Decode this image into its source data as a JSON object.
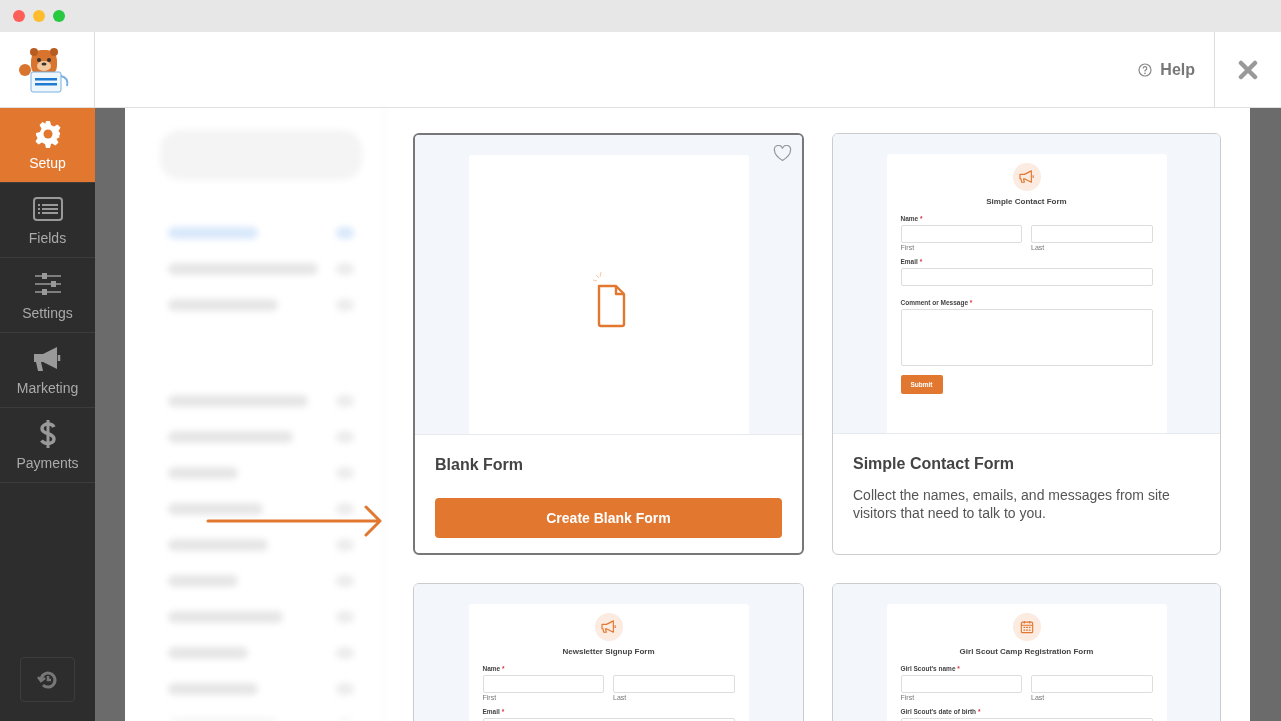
{
  "nav": {
    "items": [
      {
        "label": "Setup",
        "kind": "gear",
        "selected": true
      },
      {
        "label": "Fields",
        "kind": "list",
        "selected": false
      },
      {
        "label": "Settings",
        "kind": "sliders",
        "selected": false
      },
      {
        "label": "Marketing",
        "kind": "megaphone",
        "selected": false
      },
      {
        "label": "Payments",
        "kind": "dollar",
        "selected": false
      }
    ]
  },
  "header": {
    "help": "Help"
  },
  "templates": [
    {
      "kind": "blank",
      "name": "Blank Form",
      "selected": true,
      "favorite": false,
      "button": "Create Blank Form"
    },
    {
      "kind": "form",
      "name": "Simple Contact Form",
      "selected": false,
      "description": "Collect the names, emails, and messages from site visitors that need to talk to you.",
      "preview": {
        "title": "Simple Contact Form",
        "fields": [
          {
            "kind": "split",
            "label": "Name",
            "mark": "*",
            "sublabels": [
              "First",
              "Last"
            ]
          },
          {
            "kind": "single",
            "label": "Email",
            "mark": "*"
          },
          {
            "kind": "textarea",
            "label": "Comment or Message",
            "mark": "*"
          }
        ],
        "submit": "Submit"
      }
    },
    {
      "kind": "form",
      "selected": false,
      "preview": {
        "title": "Newsletter Signup Form",
        "fields": [
          {
            "kind": "split",
            "label": "Name",
            "mark": "*",
            "sublabels": [
              "First",
              "Last"
            ]
          },
          {
            "kind": "single",
            "label": "Email",
            "mark": "*"
          }
        ]
      }
    },
    {
      "kind": "form",
      "selected": false,
      "preview": {
        "title": "Girl Scout Camp Registration Form",
        "fields": [
          {
            "kind": "split",
            "label": "Girl Scout's name",
            "mark": "*",
            "sublabels": [
              "First",
              "Last"
            ]
          },
          {
            "kind": "single",
            "label": "Girl Scout's date of birth",
            "mark": "*"
          }
        ]
      }
    }
  ]
}
